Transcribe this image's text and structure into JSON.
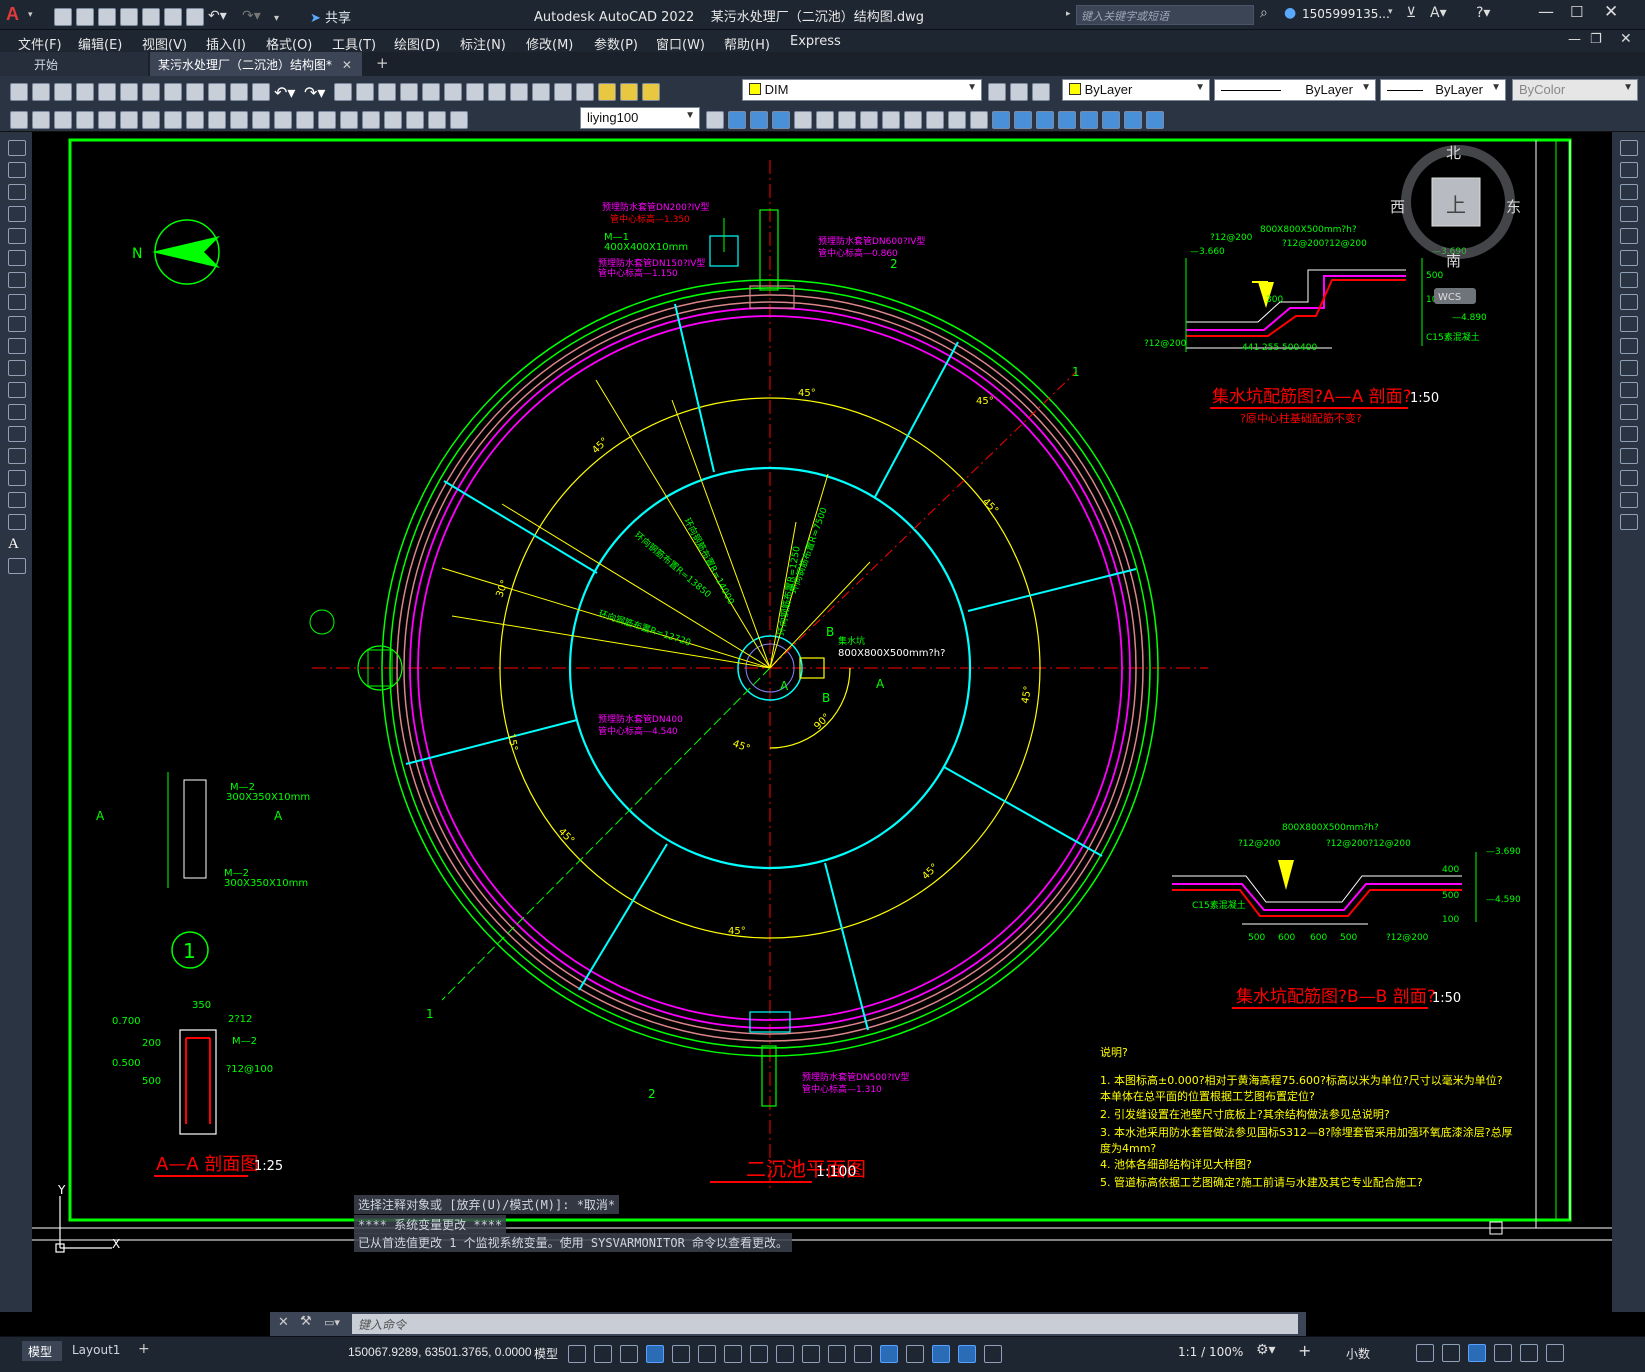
{
  "app": {
    "title": "Autodesk AutoCAD 2022",
    "filename": "某污水处理厂（二沉池）结构图.dwg",
    "share_label": "共享",
    "search_placeholder": "键入关键字或短语",
    "user": "1505999135...",
    "logo_letter": "A"
  },
  "menu": [
    "文件(F)",
    "编辑(E)",
    "视图(V)",
    "插入(I)",
    "格式(O)",
    "工具(T)",
    "绘图(D)",
    "标注(N)",
    "修改(M)",
    "参数(P)",
    "窗口(W)",
    "帮助(H)",
    "Express"
  ],
  "tabs": [
    {
      "label": "开始"
    },
    {
      "label": "某污水处理厂（二沉池）结构图*"
    }
  ],
  "toolbar": {
    "layer": "DIM",
    "color": "ByLayer",
    "linetype": "ByLayer",
    "lineweight": "ByLayer",
    "plotstyle": "ByColor",
    "dimstyle": "liying100"
  },
  "viewcube": {
    "north": "北",
    "south": "南",
    "east": "东",
    "west": "西",
    "top": "上",
    "wcs": "WCS"
  },
  "drawing": {
    "plan_title": "二沉池平面图",
    "plan_scale": "1:100",
    "aa_title": "A—A 剖面图",
    "aa_scale": "1:25",
    "sec_a_title": "集水坑配筋图?A—A 剖面?",
    "sec_a_scale": "1:50",
    "sec_a_note": "?原中心柱基础配筋不变?",
    "sec_b_title": "集水坑配筋图?B—B 剖面?",
    "sec_b_scale": "1:50",
    "pipe_in": "预埋防水套管DN200?IV型",
    "pipe_in_elev": "管中心标高—1.350",
    "m1": "M—1",
    "m1_size": "400X400X10mm",
    "pipe_150": "预埋防水套管DN150?IV型",
    "pipe_150_elev": "管中心标高—1.150",
    "pipe_600": "预埋防水套管DN600?IV型",
    "pipe_600_elev": "管中心标高—0.860",
    "pipe_400": "预埋防水套管DN400",
    "pipe_400_elev": "管中心标高—4.540",
    "pipe_500": "预埋防水套管DN500?IV型",
    "pipe_500_elev": "管中心标高—1.310",
    "pit": "集水坑",
    "pit_size": "800X800X500mm?h?",
    "r_labels": [
      "环向钢筋布置R=14000",
      "环向钢筋布置R=12720",
      "环向钢筋布置R=13850",
      "环向钢筋布置R=7500",
      "环向钢筋布置R=1250"
    ],
    "angles": [
      "45°",
      "45°",
      "45°",
      "30°",
      "45°",
      "15°",
      "45°",
      "45°",
      "90°",
      "45°",
      "45°",
      "45°"
    ],
    "m2a": "M—2",
    "m2a_size": "300X350X10mm",
    "m2b": "M—2",
    "m2b_size": "300X350X10mm",
    "aa_dims": [
      "350",
      "2?12",
      "M—2",
      "?12@100",
      "0.700",
      "0.500",
      "200",
      "500"
    ],
    "sec_a_dims": [
      "800X800X500mm?h?",
      "?12@200",
      "?12@200?12@200",
      "—3.660",
      "—3.690",
      "—4.890",
      "300",
      "441",
      "255",
      "500",
      "400",
      "500",
      "100",
      "C15素混凝土",
      "?12@200"
    ],
    "sec_b_dims": [
      "800X800X500mm?h?",
      "?12@200",
      "?12@200?12@200",
      "—3.690",
      "—4.590",
      "500",
      "600",
      "600",
      "500",
      "400",
      "500",
      "100",
      "C15素混凝土",
      "?12@200"
    ],
    "notes_title": "说明?",
    "notes": [
      "1. 本图标高±0.000?相对于黄海高程75.600?标高以米为单位?尺寸以毫米为单位?",
      "   本单体在总平面的位置根据工艺图布置定位?",
      "2. 引发缝设置在池壁尺寸底板上?其余结构做法参见总说明?",
      "3. 本水池采用防水套管做法参见国标S312—8?除埋套管采用加强环氧底漆涂层?总厚",
      "   度为4mm?",
      "4. 池体各细部结构详见大样图?",
      "5. 管道标高依据工艺图确定?施工前请与水建及其它专业配合施工?"
    ],
    "section_marks": [
      "1",
      "2",
      "1",
      "2",
      "A",
      "A",
      "B",
      "B",
      "A",
      "A"
    ],
    "detail_no": "1",
    "elevation_left": "0.700 500 0.500"
  },
  "cmd_history": [
    "选择注释对象或 [放弃(U)/模式(M)]: *取消*",
    "**** 系统变量更改 ****",
    "已从首选值更改 1 个监视系统变量。使用 SYSVARMONITOR 命令以查看更改。"
  ],
  "cmd_placeholder": "键入命令",
  "layout_tabs": [
    "模型",
    "Layout1"
  ],
  "status": {
    "coords": "150067.9289, 63501.3765, 0.0000",
    "space": "模型",
    "scale": "1:1 / 100%",
    "units": "小数"
  },
  "colors": {
    "green": "#00ff00",
    "cyan": "#00ffff",
    "yellow": "#ffff00",
    "magenta": "#ff00ff",
    "red": "#ff0000",
    "pink": "#d9868a",
    "white": "#ffffff",
    "accent": "#2a6cb5"
  }
}
